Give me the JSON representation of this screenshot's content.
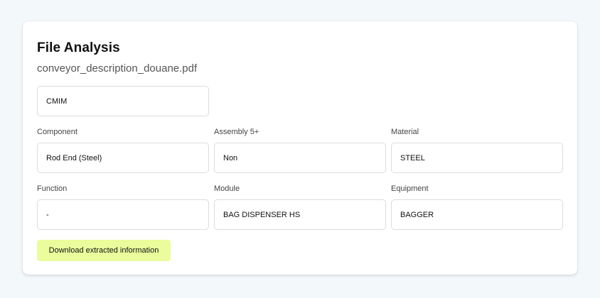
{
  "card": {
    "title": "File Analysis",
    "filename": "conveyor_description_douane.pdf",
    "top_field_value": "CMIM"
  },
  "fields": [
    {
      "label": "Component",
      "value": "Rod End (Steel)"
    },
    {
      "label": "Assembly 5+",
      "value": "Non"
    },
    {
      "label": "Material",
      "value": "STEEL"
    },
    {
      "label": "Function",
      "value": "-"
    },
    {
      "label": "Module",
      "value": "BAG DISPENSER HS"
    },
    {
      "label": "Equipment",
      "value": "BAGGER"
    }
  ],
  "download_button": {
    "label": "Download extracted information"
  },
  "colors": {
    "page_background": "#f3f8fb",
    "button_background": "#eafc9b"
  }
}
